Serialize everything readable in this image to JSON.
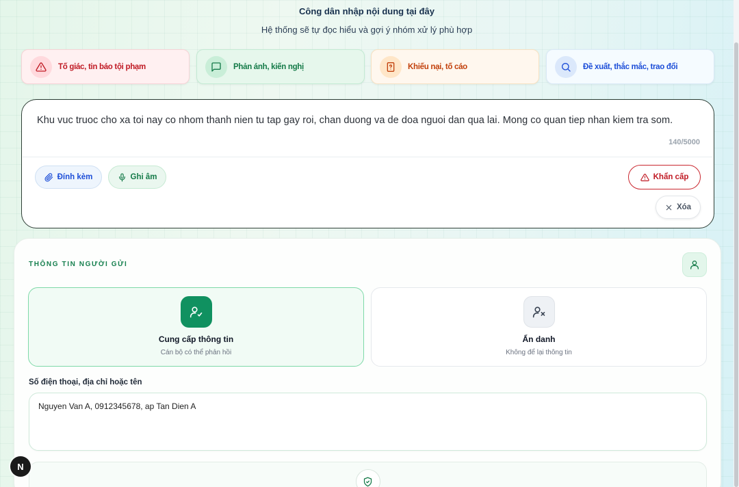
{
  "header": {
    "title": "Công dân nhập nội dung tại đây",
    "subtitle": "Hệ thống sẽ tự đọc hiểu và gợi ý nhóm xử lý phù hợp"
  },
  "categories": [
    {
      "label": "Tố giác, tin báo tội phạm",
      "icon": "alert-triangle-icon",
      "color": "#c01a24"
    },
    {
      "label": "Phản ánh, kiến nghị",
      "icon": "message-square-icon",
      "color": "#147a48"
    },
    {
      "label": "Khiếu nại, tố cáo",
      "icon": "file-question-icon",
      "color": "#c2410c"
    },
    {
      "label": "Đề xuất, thắc mắc, trao đổi",
      "icon": "search-icon",
      "color": "#1d4ed8"
    }
  ],
  "message": {
    "text": "Khu vuc truoc cho xa toi nay co nhom thanh nien tu tap gay roi, chan duong va de doa nguoi dan qua lai. Mong co quan tiep nhan kiem tra som.",
    "char_count": "140/5000"
  },
  "actions": {
    "attach_label": "Đính kèm",
    "record_label": "Ghi âm",
    "urgent_label": "Khẩn cấp",
    "clear_label": "Xóa"
  },
  "sender": {
    "heading": "THÔNG TIN NGƯỜI GỬI",
    "options": [
      {
        "title": "Cung cấp thông tin",
        "description": "Cán bộ có thể phản hồi",
        "selected": true
      },
      {
        "title": "Ẩn danh",
        "description": "Không để lại thông tin",
        "selected": false
      }
    ],
    "field_label": "Số điện thoại, địa chỉ hoặc tên",
    "field_value": "Nguyen Van A, 0912345678, ap Tan Dien A"
  },
  "badge": {
    "letter": "N"
  },
  "colors": {
    "primary_green": "#109160",
    "urgent_red": "#c9262e",
    "link_blue": "#1d4ed8"
  }
}
